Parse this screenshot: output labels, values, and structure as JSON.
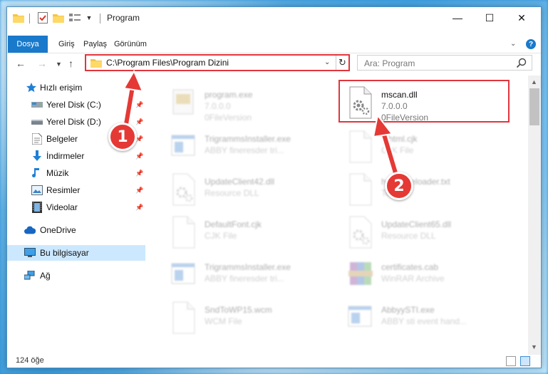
{
  "window": {
    "title": "Program",
    "controls": {
      "minimize": "—",
      "maximize": "☐",
      "close": "✕"
    }
  },
  "ribbon": {
    "tabs": [
      "Dosya",
      "Giriş",
      "Paylaş",
      "Görünüm"
    ],
    "help": "?"
  },
  "address_bar": {
    "path": "C:\\Program Files\\Program Dizini",
    "search_placeholder": "Ara: Program"
  },
  "sidebar": {
    "quick_access": "Hızlı erişim",
    "pinned": [
      "Yerel Disk (C:)",
      "Yerel Disk (D:)",
      "Belgeler",
      "İndirmeler",
      "Müzik",
      "Resimler",
      "Videolar"
    ],
    "onedrive": "OneDrive",
    "this_pc": "Bu bilgisayar",
    "network": "Ağ"
  },
  "files": [
    {
      "name": "program.exe",
      "line1": "7.0.0.0",
      "line2": "0FileVersion",
      "icon": "exe-icon",
      "highlighted": false
    },
    {
      "name": "mscan.dll",
      "line1": "7.0.0.0",
      "line2": "0FileVersion",
      "icon": "dll-gear-icon",
      "highlighted": true
    },
    {
      "name": "TrigrammsInstaller.exe",
      "line1": "ABBY fineresder tri...",
      "line2": "",
      "icon": "window-icon",
      "highlighted": false
    },
    {
      "name": "...html.cjk",
      "line1": "CJK File",
      "line2": "",
      "icon": "document-icon",
      "highlighted": false
    },
    {
      "name": "UpdateClient42.dll",
      "line1": "Resource DLL",
      "line2": "",
      "icon": "dll-gear-icon",
      "highlighted": false
    },
    {
      "name": "help...fileloader.txt",
      "line1": "Text...",
      "line2": "",
      "icon": "document-icon",
      "highlighted": false
    },
    {
      "name": "DefaultFont.cjk",
      "line1": "CJK File",
      "line2": "",
      "icon": "document-icon",
      "highlighted": false
    },
    {
      "name": "UpdateClient65.dll",
      "line1": "Resource DLL",
      "line2": "",
      "icon": "dll-gear-icon",
      "highlighted": false
    },
    {
      "name": "TrigrammsInstaller.exe",
      "line1": "ABBY fineresder tri...",
      "line2": "",
      "icon": "window-icon",
      "highlighted": false
    },
    {
      "name": "certificates.cab",
      "line1": "WinRAR Archive",
      "line2": "",
      "icon": "archive-icon",
      "highlighted": false
    },
    {
      "name": "SndToWP15.wcm",
      "line1": "WCM File",
      "line2": "",
      "icon": "document-icon",
      "highlighted": false
    },
    {
      "name": "AbbyySTI.exe",
      "line1": "ABBY sti event hand...",
      "line2": "",
      "icon": "window-icon",
      "highlighted": false
    }
  ],
  "status_bar": {
    "item_count": "124 öğe"
  },
  "annotations": {
    "step1": "1",
    "step2": "2",
    "color": "#e0363c"
  }
}
